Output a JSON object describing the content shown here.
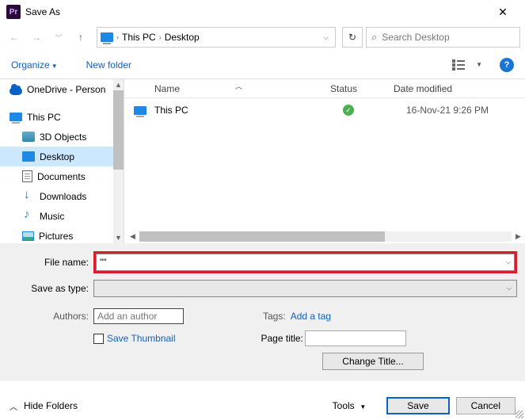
{
  "title": "Save As",
  "breadcrumbs": {
    "root": "This PC",
    "current": "Desktop"
  },
  "search": {
    "placeholder": "Search Desktop"
  },
  "toolbar": {
    "organize": "Organize",
    "newfolder": "New folder"
  },
  "tree": {
    "onedrive": "OneDrive - Person",
    "thispc": "This PC",
    "objects3d": "3D Objects",
    "desktop": "Desktop",
    "documents": "Documents",
    "downloads": "Downloads",
    "music": "Music",
    "pictures": "Pictures"
  },
  "columns": {
    "name": "Name",
    "status": "Status",
    "date": "Date modified"
  },
  "rows": [
    {
      "name": "This PC",
      "date": "16-Nov-21 9:26 PM"
    }
  ],
  "form": {
    "filename_label": "File name:",
    "filename_value": "\"\"",
    "type_label": "Save as type:",
    "authors_label": "Authors:",
    "authors_placeholder": "Add an author",
    "tags_label": "Tags:",
    "tags_add": "Add a tag",
    "save_thumb": "Save Thumbnail",
    "pagetitle_label": "Page title:",
    "change_title": "Change Title..."
  },
  "footer": {
    "hide": "Hide Folders",
    "tools": "Tools",
    "save": "Save",
    "cancel": "Cancel"
  }
}
